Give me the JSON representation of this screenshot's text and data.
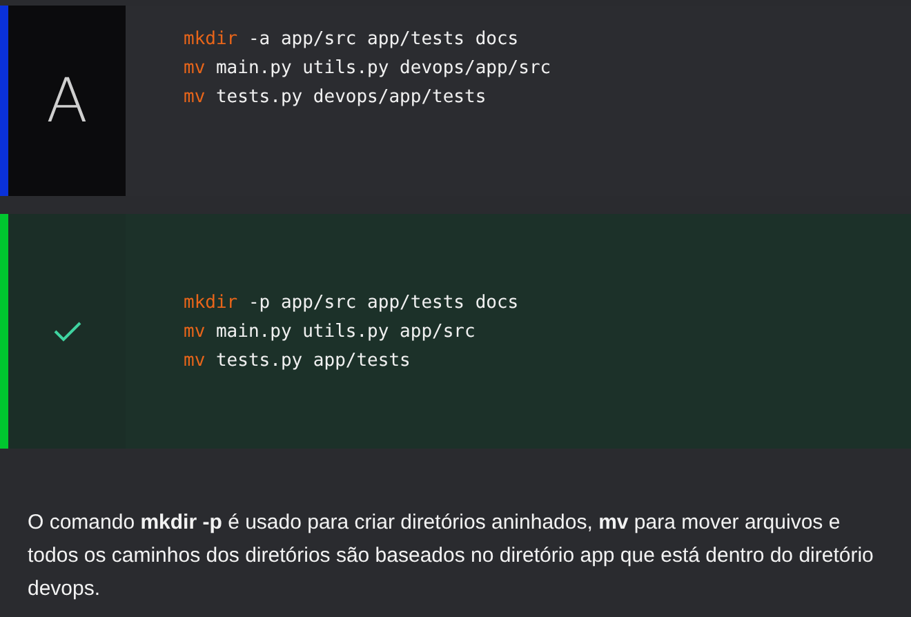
{
  "options": [
    {
      "kind": "letter",
      "letter": "A",
      "lines": [
        {
          "command": "mkdir",
          "args": "-a app/src app/tests docs"
        },
        {
          "command": "mv",
          "args": "main.py utils.py devops/app/src"
        },
        {
          "command": "mv",
          "args": "tests.py devops/app/tests"
        }
      ]
    },
    {
      "kind": "correct",
      "lines": [
        {
          "command": "mkdir",
          "args": "-p app/src app/tests docs"
        },
        {
          "command": "mv",
          "args": "main.py utils.py app/src"
        },
        {
          "command": "mv",
          "args": "tests.py app/tests"
        }
      ]
    }
  ],
  "explanation": "O comando **mkdir -p** é usado para criar diretórios aninhados, **mv** para mover arquivos e todos os caminhos dos diretórios são baseados no diretório app que está dentro do diretório devops."
}
